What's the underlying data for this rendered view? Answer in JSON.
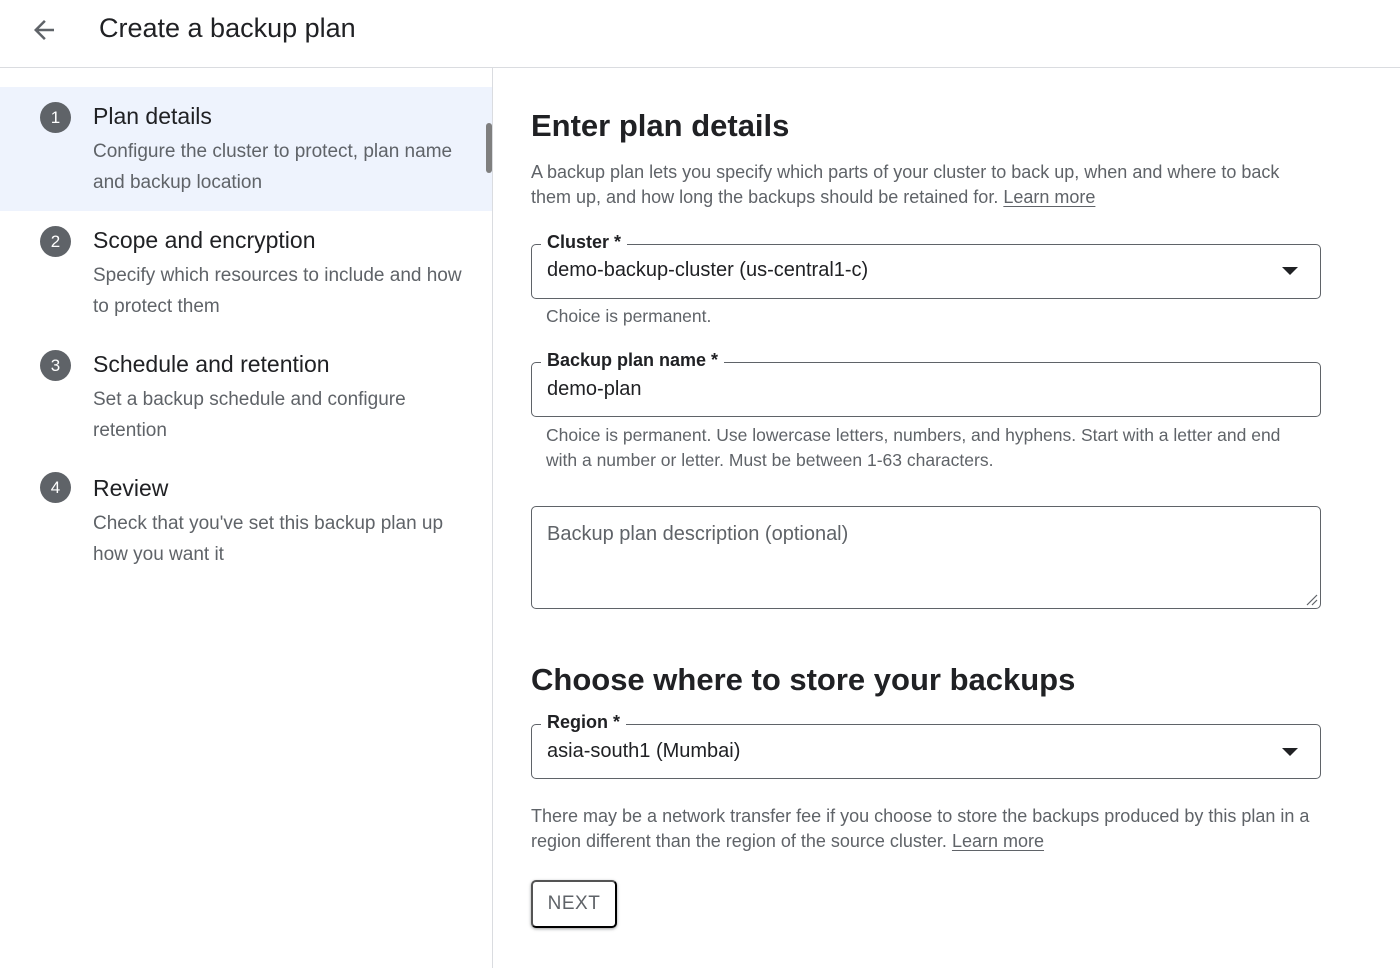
{
  "header": {
    "title": "Create a backup plan",
    "back_icon": "arrow-back-icon"
  },
  "sidebar": {
    "steps": [
      {
        "number": "1",
        "title": "Plan details",
        "description": "Configure the cluster to protect, plan name and backup location"
      },
      {
        "number": "2",
        "title": "Scope and encryption",
        "description": "Specify which resources to include and how to protect them"
      },
      {
        "number": "3",
        "title": "Schedule and retention",
        "description": "Set a backup schedule and configure retention"
      },
      {
        "number": "4",
        "title": "Review",
        "description": "Check that you've set this backup plan up how you want it"
      }
    ]
  },
  "main": {
    "section1_title": "Enter plan details",
    "intro_text": "A backup plan lets you specify which parts of your cluster to back up, when and where to back them up, and how long the backups should be retained for.",
    "intro_link": "Learn more",
    "cluster": {
      "label": "Cluster *",
      "value": "demo-backup-cluster (us-central1-c)",
      "hint": "Choice is permanent."
    },
    "plan_name": {
      "label": "Backup plan name *",
      "value": "demo-plan",
      "hint": "Choice is permanent. Use lowercase letters, numbers, and hyphens. Start with a letter and end with a number or letter. Must be between 1-63 characters."
    },
    "description": {
      "placeholder": "Backup plan description (optional)"
    },
    "section2_title": "Choose where to store your backups",
    "region": {
      "label": "Region *",
      "value": "asia-south1 (Mumbai)"
    },
    "region_note": "There may be a network transfer fee if you choose to store the backups produced by this plan in a region different than the region of the source cluster.",
    "region_link": "Learn more",
    "next_label": "NEXT"
  },
  "colors": {
    "active_step_bg": "#eef3fd",
    "step_badge": "#5f6368",
    "text_primary": "#202124",
    "text_secondary": "#5f6368"
  }
}
